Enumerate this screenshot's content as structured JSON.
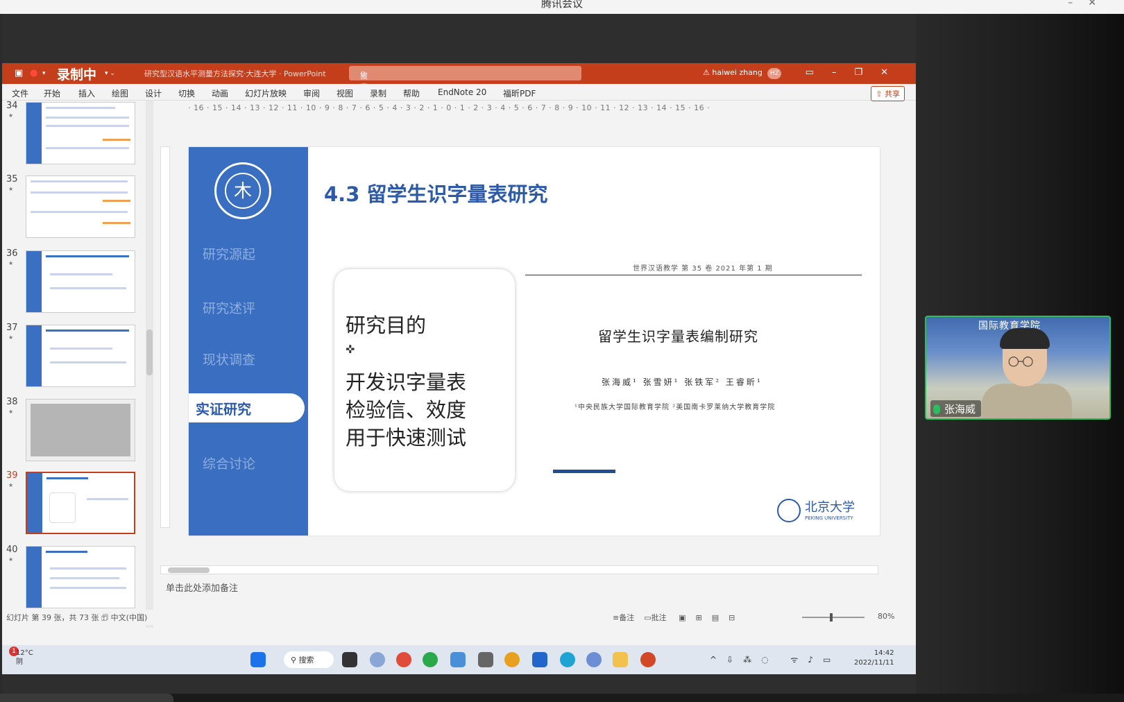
{
  "meeting": {
    "title": "腾讯会议",
    "participant_name": "张海威",
    "video_brand": "国际教育学院"
  },
  "ppt": {
    "recording_label": "录制中",
    "doc_title": "研究型汉语水平测量方法探究·大连大学 · PowerPoint",
    "search_placeholder": "搜索",
    "user_name": "haiwei zhang",
    "user_initials": "HZ",
    "share_label": "共享",
    "tabs": [
      "文件",
      "开始",
      "插入",
      "绘图",
      "设计",
      "切换",
      "动画",
      "幻灯片放映",
      "审阅",
      "视图",
      "录制",
      "帮助",
      "EndNote 20",
      "福昕PDF"
    ],
    "ruler": "· 16 · 15 · 14 · 13 · 12 · 11 · 10 · 9 · 8 · 7 · 6 · 5 · 4 · 3 · 2 · 1 · 0 · 1 · 2 · 3 · 4 · 5 · 6 · 7 · 8 · 9 · 10 · 11 · 12 · 13 · 14 · 15 · 16 ·",
    "thumbnails": [
      "34",
      "35",
      "36",
      "37",
      "38",
      "39",
      "40"
    ],
    "selected_slide": "39",
    "notes_placeholder": "单击此处添加备注",
    "status": {
      "slide_info": "幻灯片 第 39 张，共 73 张",
      "language": "中文(中国)",
      "notes_btn": "备注",
      "comments_btn": "批注",
      "zoom": "80%"
    }
  },
  "slide": {
    "title": "4.3 留学生识字量表研究",
    "nav": [
      "研究源起",
      "研究述评",
      "现状调查",
      "实证研究",
      "综合讨论"
    ],
    "nav_active": "实证研究",
    "card": {
      "heading": "研究目的",
      "lines": [
        "开发识字量表",
        "检验信、效度",
        "用于快速测试"
      ]
    },
    "paper": {
      "journal": "世界汉语教学 第 35 卷 2021 年第 1 期",
      "title": "留学生识字量表编制研究",
      "authors": "张海威¹  张雪妍¹  张铁军²  王睿昕¹",
      "affiliations": "¹中央民族大学国际教育学院   ²美国南卡罗莱纳大学教育学院"
    },
    "logo_name": "北京大学",
    "logo_en": "PEKING UNIVERSITY"
  },
  "taskbar": {
    "weather_temp": "12°C",
    "weather_desc": "阴",
    "notification_count": "1",
    "search_label": "搜索",
    "time": "14:42",
    "date": "2022/11/11"
  }
}
